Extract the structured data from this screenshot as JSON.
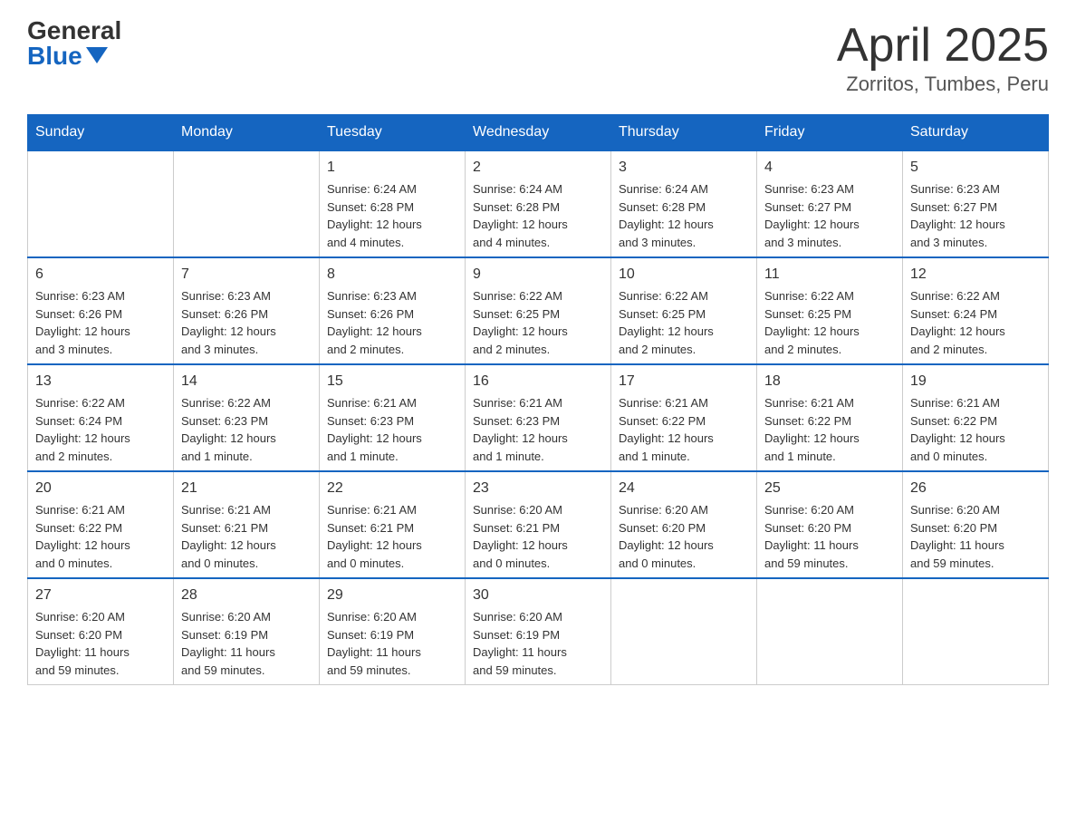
{
  "header": {
    "logo_general": "General",
    "logo_blue": "Blue",
    "title": "April 2025",
    "location": "Zorritos, Tumbes, Peru"
  },
  "days_of_week": [
    "Sunday",
    "Monday",
    "Tuesday",
    "Wednesday",
    "Thursday",
    "Friday",
    "Saturday"
  ],
  "weeks": [
    [
      {
        "day": "",
        "info": ""
      },
      {
        "day": "",
        "info": ""
      },
      {
        "day": "1",
        "info": "Sunrise: 6:24 AM\nSunset: 6:28 PM\nDaylight: 12 hours\nand 4 minutes."
      },
      {
        "day": "2",
        "info": "Sunrise: 6:24 AM\nSunset: 6:28 PM\nDaylight: 12 hours\nand 4 minutes."
      },
      {
        "day": "3",
        "info": "Sunrise: 6:24 AM\nSunset: 6:28 PM\nDaylight: 12 hours\nand 3 minutes."
      },
      {
        "day": "4",
        "info": "Sunrise: 6:23 AM\nSunset: 6:27 PM\nDaylight: 12 hours\nand 3 minutes."
      },
      {
        "day": "5",
        "info": "Sunrise: 6:23 AM\nSunset: 6:27 PM\nDaylight: 12 hours\nand 3 minutes."
      }
    ],
    [
      {
        "day": "6",
        "info": "Sunrise: 6:23 AM\nSunset: 6:26 PM\nDaylight: 12 hours\nand 3 minutes."
      },
      {
        "day": "7",
        "info": "Sunrise: 6:23 AM\nSunset: 6:26 PM\nDaylight: 12 hours\nand 3 minutes."
      },
      {
        "day": "8",
        "info": "Sunrise: 6:23 AM\nSunset: 6:26 PM\nDaylight: 12 hours\nand 2 minutes."
      },
      {
        "day": "9",
        "info": "Sunrise: 6:22 AM\nSunset: 6:25 PM\nDaylight: 12 hours\nand 2 minutes."
      },
      {
        "day": "10",
        "info": "Sunrise: 6:22 AM\nSunset: 6:25 PM\nDaylight: 12 hours\nand 2 minutes."
      },
      {
        "day": "11",
        "info": "Sunrise: 6:22 AM\nSunset: 6:25 PM\nDaylight: 12 hours\nand 2 minutes."
      },
      {
        "day": "12",
        "info": "Sunrise: 6:22 AM\nSunset: 6:24 PM\nDaylight: 12 hours\nand 2 minutes."
      }
    ],
    [
      {
        "day": "13",
        "info": "Sunrise: 6:22 AM\nSunset: 6:24 PM\nDaylight: 12 hours\nand 2 minutes."
      },
      {
        "day": "14",
        "info": "Sunrise: 6:22 AM\nSunset: 6:23 PM\nDaylight: 12 hours\nand 1 minute."
      },
      {
        "day": "15",
        "info": "Sunrise: 6:21 AM\nSunset: 6:23 PM\nDaylight: 12 hours\nand 1 minute."
      },
      {
        "day": "16",
        "info": "Sunrise: 6:21 AM\nSunset: 6:23 PM\nDaylight: 12 hours\nand 1 minute."
      },
      {
        "day": "17",
        "info": "Sunrise: 6:21 AM\nSunset: 6:22 PM\nDaylight: 12 hours\nand 1 minute."
      },
      {
        "day": "18",
        "info": "Sunrise: 6:21 AM\nSunset: 6:22 PM\nDaylight: 12 hours\nand 1 minute."
      },
      {
        "day": "19",
        "info": "Sunrise: 6:21 AM\nSunset: 6:22 PM\nDaylight: 12 hours\nand 0 minutes."
      }
    ],
    [
      {
        "day": "20",
        "info": "Sunrise: 6:21 AM\nSunset: 6:22 PM\nDaylight: 12 hours\nand 0 minutes."
      },
      {
        "day": "21",
        "info": "Sunrise: 6:21 AM\nSunset: 6:21 PM\nDaylight: 12 hours\nand 0 minutes."
      },
      {
        "day": "22",
        "info": "Sunrise: 6:21 AM\nSunset: 6:21 PM\nDaylight: 12 hours\nand 0 minutes."
      },
      {
        "day": "23",
        "info": "Sunrise: 6:20 AM\nSunset: 6:21 PM\nDaylight: 12 hours\nand 0 minutes."
      },
      {
        "day": "24",
        "info": "Sunrise: 6:20 AM\nSunset: 6:20 PM\nDaylight: 12 hours\nand 0 minutes."
      },
      {
        "day": "25",
        "info": "Sunrise: 6:20 AM\nSunset: 6:20 PM\nDaylight: 11 hours\nand 59 minutes."
      },
      {
        "day": "26",
        "info": "Sunrise: 6:20 AM\nSunset: 6:20 PM\nDaylight: 11 hours\nand 59 minutes."
      }
    ],
    [
      {
        "day": "27",
        "info": "Sunrise: 6:20 AM\nSunset: 6:20 PM\nDaylight: 11 hours\nand 59 minutes."
      },
      {
        "day": "28",
        "info": "Sunrise: 6:20 AM\nSunset: 6:19 PM\nDaylight: 11 hours\nand 59 minutes."
      },
      {
        "day": "29",
        "info": "Sunrise: 6:20 AM\nSunset: 6:19 PM\nDaylight: 11 hours\nand 59 minutes."
      },
      {
        "day": "30",
        "info": "Sunrise: 6:20 AM\nSunset: 6:19 PM\nDaylight: 11 hours\nand 59 minutes."
      },
      {
        "day": "",
        "info": ""
      },
      {
        "day": "",
        "info": ""
      },
      {
        "day": "",
        "info": ""
      }
    ]
  ]
}
